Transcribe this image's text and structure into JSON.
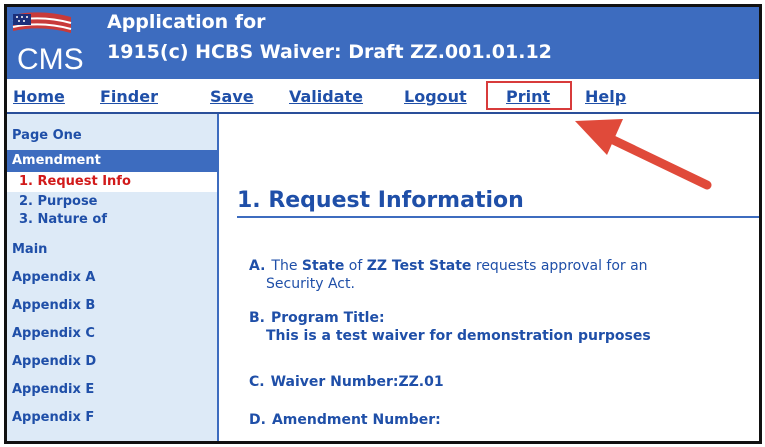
{
  "header": {
    "logo_text": "CMS",
    "title_line1": "Application for",
    "title_line2": "1915(c) HCBS Waiver: Draft ZZ.001.01.12"
  },
  "nav": {
    "items": [
      "Home",
      "Finder",
      "Save",
      "Validate",
      "Logout",
      "Print",
      "Help"
    ],
    "highlighted": "Print",
    "highlight_color": "#d83b3b"
  },
  "sidebar": {
    "page_one": "Page One",
    "amendment": "Amendment",
    "sub_items": [
      "1. Request Info",
      "2. Purpose",
      "3. Nature of"
    ],
    "current": "1. Request Info",
    "sections": [
      "Main",
      "Appendix A",
      "Appendix B",
      "Appendix C",
      "Appendix D",
      "Appendix E",
      "Appendix F"
    ]
  },
  "content": {
    "heading": "1. Request Information",
    "a_letter": "A.",
    "a_text_1": "The",
    "a_state_word": "State",
    "a_text_2": "of",
    "a_state_name": "ZZ Test State",
    "a_text_3": "requests approval for an",
    "a_line2": "Security Act.",
    "b_letter": "B.",
    "b_label": "Program Title:",
    "b_value": "This is a test waiver for demonstration purposes",
    "c_letter": "C.",
    "c_text": "Waiver Number:ZZ.01",
    "d_letter": "D.",
    "d_text": "Amendment Number:"
  },
  "colors": {
    "header_bg": "#3d6cbf",
    "link": "#1f4fa8",
    "sidebar_bg": "#ddeaf7",
    "current_item": "#d11a1a",
    "arrow": "#e04a3a"
  }
}
